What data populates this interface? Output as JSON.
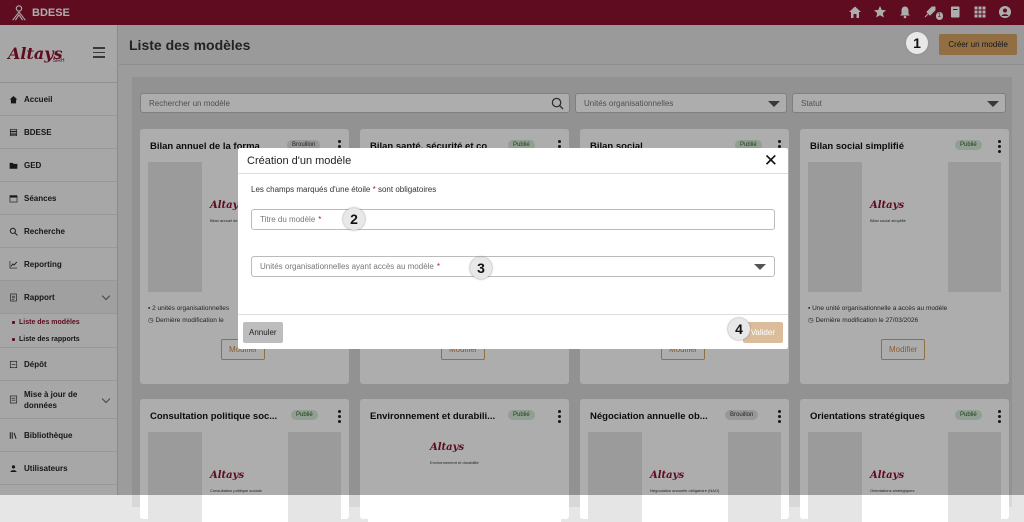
{
  "topbar": {
    "app_name": "BDESE",
    "notif_badge": "1",
    "icons": [
      "home-icon",
      "star-icon",
      "bell-icon",
      "rocket-icon",
      "book-icon",
      "apps-grid-icon",
      "user-icon"
    ]
  },
  "sidebar": {
    "items": [
      {
        "label": "Accueil",
        "icon": "home-icon"
      },
      {
        "label": "BDESE",
        "icon": "layers-icon"
      },
      {
        "label": "GED",
        "icon": "folder-icon"
      },
      {
        "label": "Séances",
        "icon": "calendar-icon"
      },
      {
        "label": "Recherche",
        "icon": "search-icon"
      },
      {
        "label": "Reporting",
        "icon": "chart-icon"
      },
      {
        "label": "Rapport",
        "icon": "report-icon"
      }
    ],
    "subitems": [
      {
        "label": "Liste des modèles"
      },
      {
        "label": "Liste des rapports"
      }
    ],
    "items2": [
      {
        "label": "Dépôt",
        "icon": "upload-icon"
      },
      {
        "label": "Mise à jour de données",
        "icon": "update-icon"
      },
      {
        "label": "Bibliothèque",
        "icon": "library-icon"
      },
      {
        "label": "Utilisateurs",
        "icon": "users-icon"
      }
    ]
  },
  "header": {
    "title": "Liste des modèles",
    "create_label": "Créer un modèle"
  },
  "filters": {
    "search_placeholder": "Rechercher un modèle",
    "units_placeholder": "Unités organisationnelles",
    "status_placeholder": "Statut"
  },
  "cards": [
    {
      "title": "Bilan annuel de la forma",
      "status": "Brouillon",
      "info1": "2 unités organisationnelles",
      "info2": "Dernière modification le",
      "modify": "Modifier",
      "doc_title": "Bilan annuel de la formation"
    },
    {
      "title": "Bilan santé, sécurité et co",
      "status": "Publié",
      "modify": "Modifier"
    },
    {
      "title": "Bilan social",
      "status": "Publié",
      "modify": "Modifier"
    },
    {
      "title": "Bilan social simplifié",
      "status": "Publié",
      "info1": "Une unité organisationnelle a accès au modèle",
      "info2": "Dernière modification le 27/03/2026",
      "modify": "Modifier",
      "doc_title": "Bilan social simplifié"
    },
    {
      "title": "Consultation politique soc...",
      "status": "Publié",
      "doc_title": "Consultation politique sociale"
    },
    {
      "title": "Environnement et durabili...",
      "status": "Publié",
      "doc_title": "Environnement et durabilité"
    },
    {
      "title": "Négociation annuelle ob...",
      "status": "Brouillon",
      "doc_title": "Négociation annuelle obligatoire (NAO)"
    },
    {
      "title": "Orientations stratégiques",
      "status": "Publié",
      "doc_title": "Orientations stratégiques"
    }
  ],
  "brand": {
    "name": "Altays",
    "sub": "SIRH"
  },
  "modal": {
    "title": "Création d'un modèle",
    "required_prefix": "Les champs marqués d'une étoile",
    "required_star": "*",
    "required_suffix": "sont obligatoires",
    "title_field": "Titre du modèle",
    "units_field": "Unités organisationnelles ayant accès au modèle",
    "cancel": "Annuler",
    "validate": "Valider"
  },
  "steps": [
    "1",
    "2",
    "3",
    "4"
  ]
}
